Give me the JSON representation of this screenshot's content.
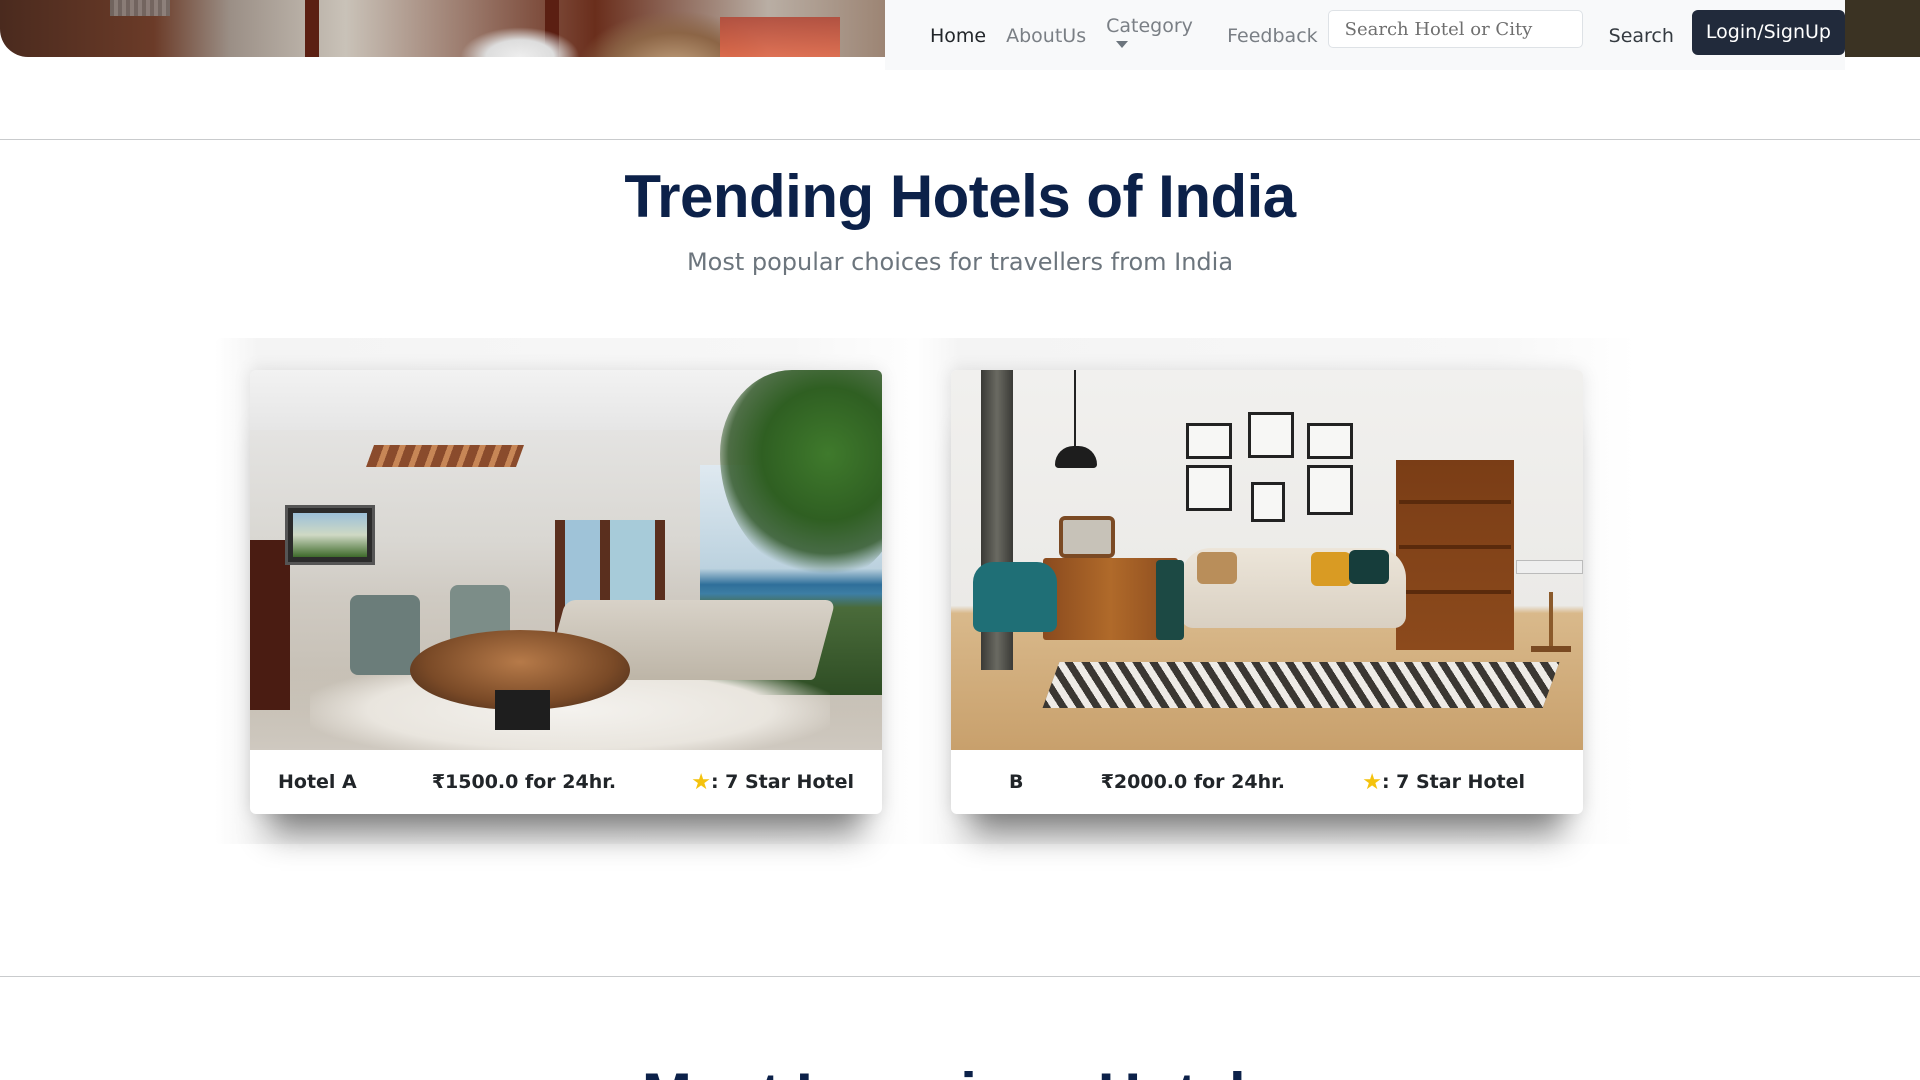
{
  "nav": {
    "links": [
      "Home",
      "AboutUs",
      "Category",
      "Feedback"
    ],
    "search_placeholder": "Search Hotel or City",
    "search_button": "Search",
    "login_button": "Login/SignUp"
  },
  "trending": {
    "title": "Trending Hotels of India",
    "subtitle": "Most popular choices for travellers from India",
    "cards": [
      {
        "name": "Hotel A",
        "price": "₹1500.0 for 24hr.",
        "rating": ": 7 Star Hotel"
      },
      {
        "name": "B",
        "price": "₹2000.0 for 24hr.",
        "rating": ": 7 Star Hotel"
      }
    ]
  },
  "luxury": {
    "title": "Most Luxurious Hotels"
  },
  "colors": {
    "navbar_bg": "#f8f9fa",
    "login_bg": "#212a3b",
    "title_color": "#0c2149",
    "star_color": "#f4c20d"
  },
  "icons": [
    "star-icon",
    "caret-down-icon"
  ]
}
